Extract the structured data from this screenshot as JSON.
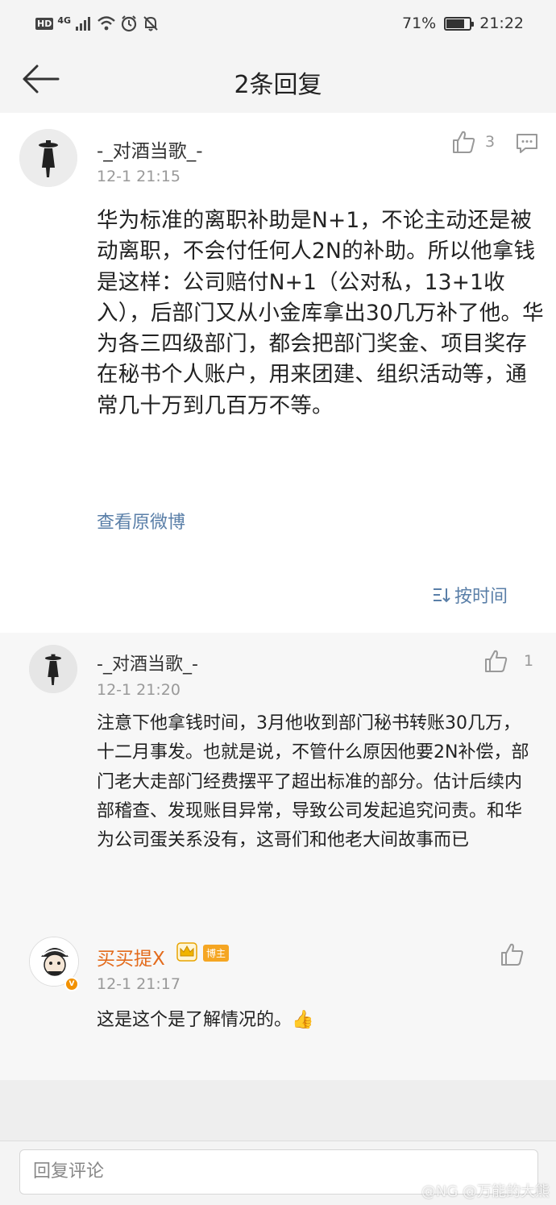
{
  "status_bar": {
    "hd": "HD",
    "network": "4G",
    "battery_percent": "71%",
    "battery_level": 0.71,
    "time": "21:22",
    "icons": [
      "signal-icon",
      "wifi-icon",
      "alarm-icon",
      "mute-icon",
      "battery-icon"
    ]
  },
  "nav": {
    "title": "2条回复",
    "back_icon": "back-arrow-icon"
  },
  "main_comment": {
    "username": "-_对酒当歌_-",
    "time": "12-1 21:15",
    "like_count": "3",
    "text": "华为标准的离职补助是N+1，不论主动还是被动离职，不会付任何人2N的补助。所以他拿钱是这样：公司赔付N+1（公对私，13+1收入），后部门又从小金库拿出30几万补了他。华为各三四级部门，都会把部门奖金、项目奖存在秘书个人账户，用来团建、组织活动等，通常几十万到几百万不等。",
    "view_original": "查看原微博",
    "sort_label": "按时间"
  },
  "replies": [
    {
      "username": "-_对酒当歌_-",
      "time": "12-1 21:20",
      "like_count": "1",
      "text": "注意下他拿钱时间，3月他收到部门秘书转账30几万，十二月事发。也就是说，不管什么原因他要2N补偿，部门老大走部门经费摆平了超出标准的部分。估计后续内部稽查、发现账目异常，导致公司发起追究问责。和华为公司蛋关系没有，这哥们和他老大间故事而已"
    },
    {
      "username": "买买提X",
      "badge": "博主",
      "verified": "V",
      "time": "12-1 21:17",
      "like_count": "",
      "text": "这是这个是了解情况的。👍"
    }
  ],
  "footer": {
    "input_placeholder": "回复评论"
  },
  "watermark": "@NG @万能的大熊",
  "colors": {
    "link": "#5a7fa8",
    "username_highlight": "#e36b1c",
    "badge": "#f5a623"
  }
}
